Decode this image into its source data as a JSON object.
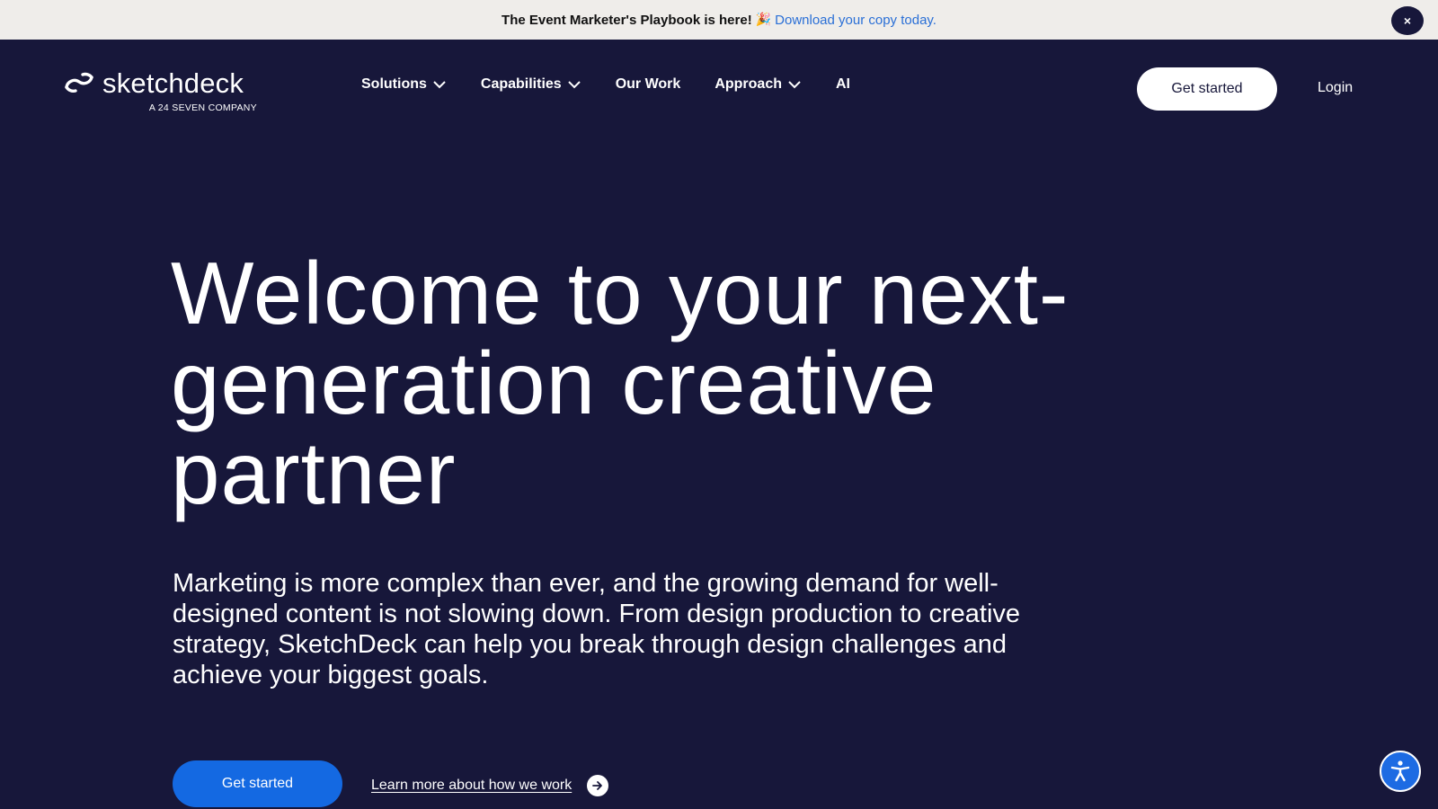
{
  "announcement": {
    "text_bold": "The Event Marketer's Playbook is here!",
    "emoji": "🎉",
    "link_text": "Download your copy today.",
    "close_label": "×"
  },
  "header": {
    "logo_word": "sketchdeck",
    "logo_sub": "A 24 SEVEN COMPANY",
    "nav": [
      {
        "label": "Solutions",
        "has_dropdown": true
      },
      {
        "label": "Capabilities",
        "has_dropdown": true
      },
      {
        "label": "Our Work",
        "has_dropdown": false
      },
      {
        "label": "Approach",
        "has_dropdown": true
      },
      {
        "label": "AI",
        "has_dropdown": false
      }
    ],
    "cta_label": "Get started",
    "login_label": "Login"
  },
  "hero": {
    "title": "Welcome to your next-generation creative partner",
    "description": "Marketing is more complex than ever, and the growing demand for well-designed content is not slowing down. From design production to creative strategy, SketchDeck can help you break through design challenges and achieve your biggest goals.",
    "cta_label": "Get started",
    "learn_more_label": "Learn more about how we work"
  },
  "colors": {
    "background": "#17173a",
    "announcement_bg": "#efedea",
    "link": "#2a6fd6",
    "primary_button": "#1469e2",
    "accessibility_button": "#1d6be3"
  },
  "icons": {
    "logo": "sketchdeck-logo-icon",
    "dropdown": "chevron-down-icon",
    "arrow": "arrow-right-icon",
    "accessibility": "accessibility-icon",
    "close": "close-icon"
  }
}
